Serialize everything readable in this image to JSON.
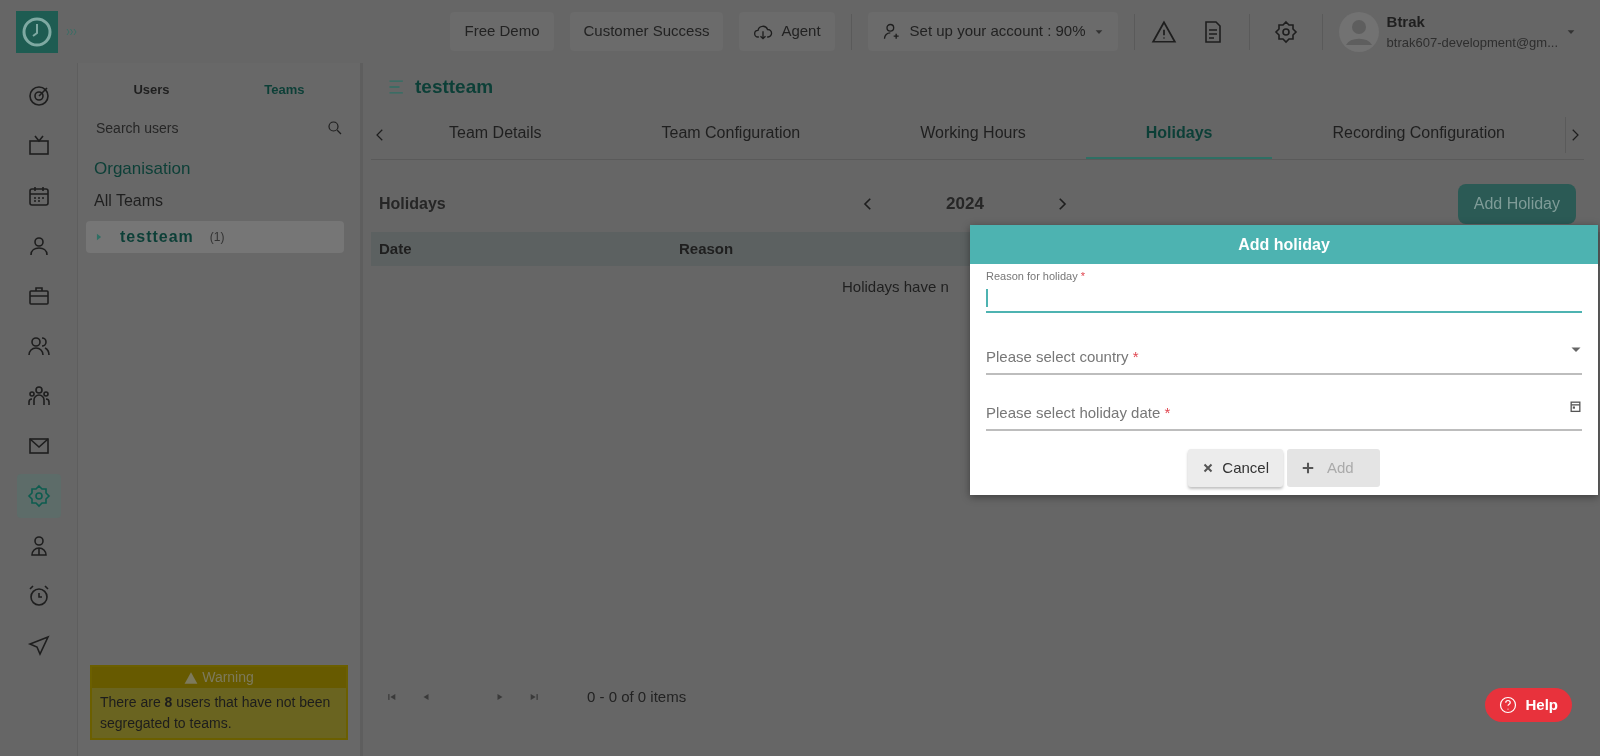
{
  "header": {
    "top_buttons": [
      {
        "label": "Free Demo",
        "kind": "plain"
      },
      {
        "label": "Customer Success",
        "kind": "plain"
      },
      {
        "label": "Agent",
        "kind": "cloud"
      }
    ],
    "setup": {
      "label": "Set up your account : 90%"
    },
    "user": {
      "name": "Btrak",
      "email": "btrak607-development@gm..."
    }
  },
  "rail": [
    {
      "selected": false
    },
    {
      "selected": false
    },
    {
      "selected": false
    },
    {
      "selected": false
    },
    {
      "selected": false
    },
    {
      "selected": false
    },
    {
      "selected": false
    },
    {
      "selected": false
    },
    {
      "selected": true
    },
    {
      "selected": false
    },
    {
      "selected": false
    },
    {
      "selected": false
    }
  ],
  "sidebar": {
    "tabs": [
      {
        "label": "Users",
        "selected": false
      },
      {
        "label": "Teams",
        "selected": true
      }
    ],
    "search": {
      "placeholder": "Search users"
    },
    "heading": "Organisation",
    "all_teams": "All Teams",
    "tree": [
      {
        "label": "testteam",
        "count": "(1)",
        "expanded": false,
        "selected": true
      }
    ],
    "warning": {
      "title": "Warning",
      "text": "There are **8** users that have not been segregated to teams."
    }
  },
  "main": {
    "title": "testteam",
    "tabs": [
      {
        "label": "Team Details",
        "selected": false
      },
      {
        "label": "Team Configuration",
        "selected": false
      },
      {
        "label": "Working Hours",
        "selected": false
      },
      {
        "label": "Holidays",
        "selected": true
      },
      {
        "label": "Recording Configuration",
        "selected": false
      }
    ],
    "section_title": "Holidays",
    "year": "2024",
    "add_button": "Add Holiday",
    "table": {
      "columns": [
        "Date",
        "Reason"
      ],
      "empty_message": "Holidays have n"
    },
    "pager": {
      "summary": "0 - 0 of 0 items"
    }
  },
  "dialog": {
    "title": "Add holiday",
    "fields": [
      {
        "kind": "text",
        "label": "Reason for holiday",
        "required": "*",
        "focused": true
      },
      {
        "kind": "select",
        "label": "Please select country",
        "required": "*",
        "focused": false
      },
      {
        "kind": "date",
        "label": "Please select holiday date",
        "required": "*",
        "focused": false
      }
    ],
    "buttons": [
      {
        "label": "Cancel",
        "kind": "cancel",
        "disabled": false
      },
      {
        "label": "Add",
        "kind": "add",
        "disabled": true
      }
    ]
  },
  "help": {
    "label": "Help"
  }
}
